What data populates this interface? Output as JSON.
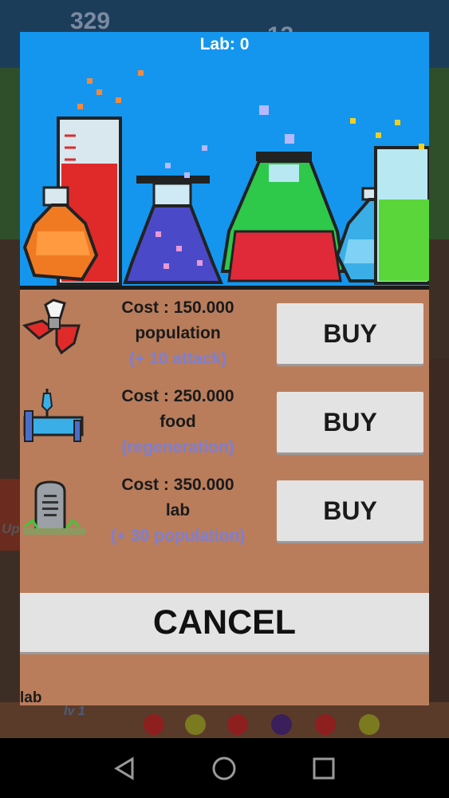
{
  "background": {
    "stat_left": "329",
    "stat_mid": "13",
    "side_label_up": "Up",
    "bottom_label_lv": "lv 1"
  },
  "dialog": {
    "title": "Lab: 0",
    "items": [
      {
        "cost": "Cost : 150.000",
        "resource": "population",
        "bonus": "(+ 10 attack)",
        "buy_label": "BUY",
        "icon": "winged-creature-icon"
      },
      {
        "cost": "Cost : 250.000",
        "resource": "food",
        "bonus": "(regeneration)",
        "buy_label": "BUY",
        "icon": "bed-iv-icon"
      },
      {
        "cost": "Cost : 350.000",
        "resource": "lab",
        "bonus": "(+ 30 population)",
        "buy_label": "BUY",
        "icon": "gravestone-icon"
      }
    ],
    "cancel_label": "CANCEL",
    "footer_label": "lab"
  },
  "colors": {
    "header_bg": "#1496ee",
    "dialog_bg": "#b97d5c",
    "button_bg": "#e3e3e3",
    "bonus_text": "#7b7fd6"
  },
  "navbar": {
    "back": "back-icon",
    "home": "home-icon",
    "recents": "recents-icon"
  }
}
